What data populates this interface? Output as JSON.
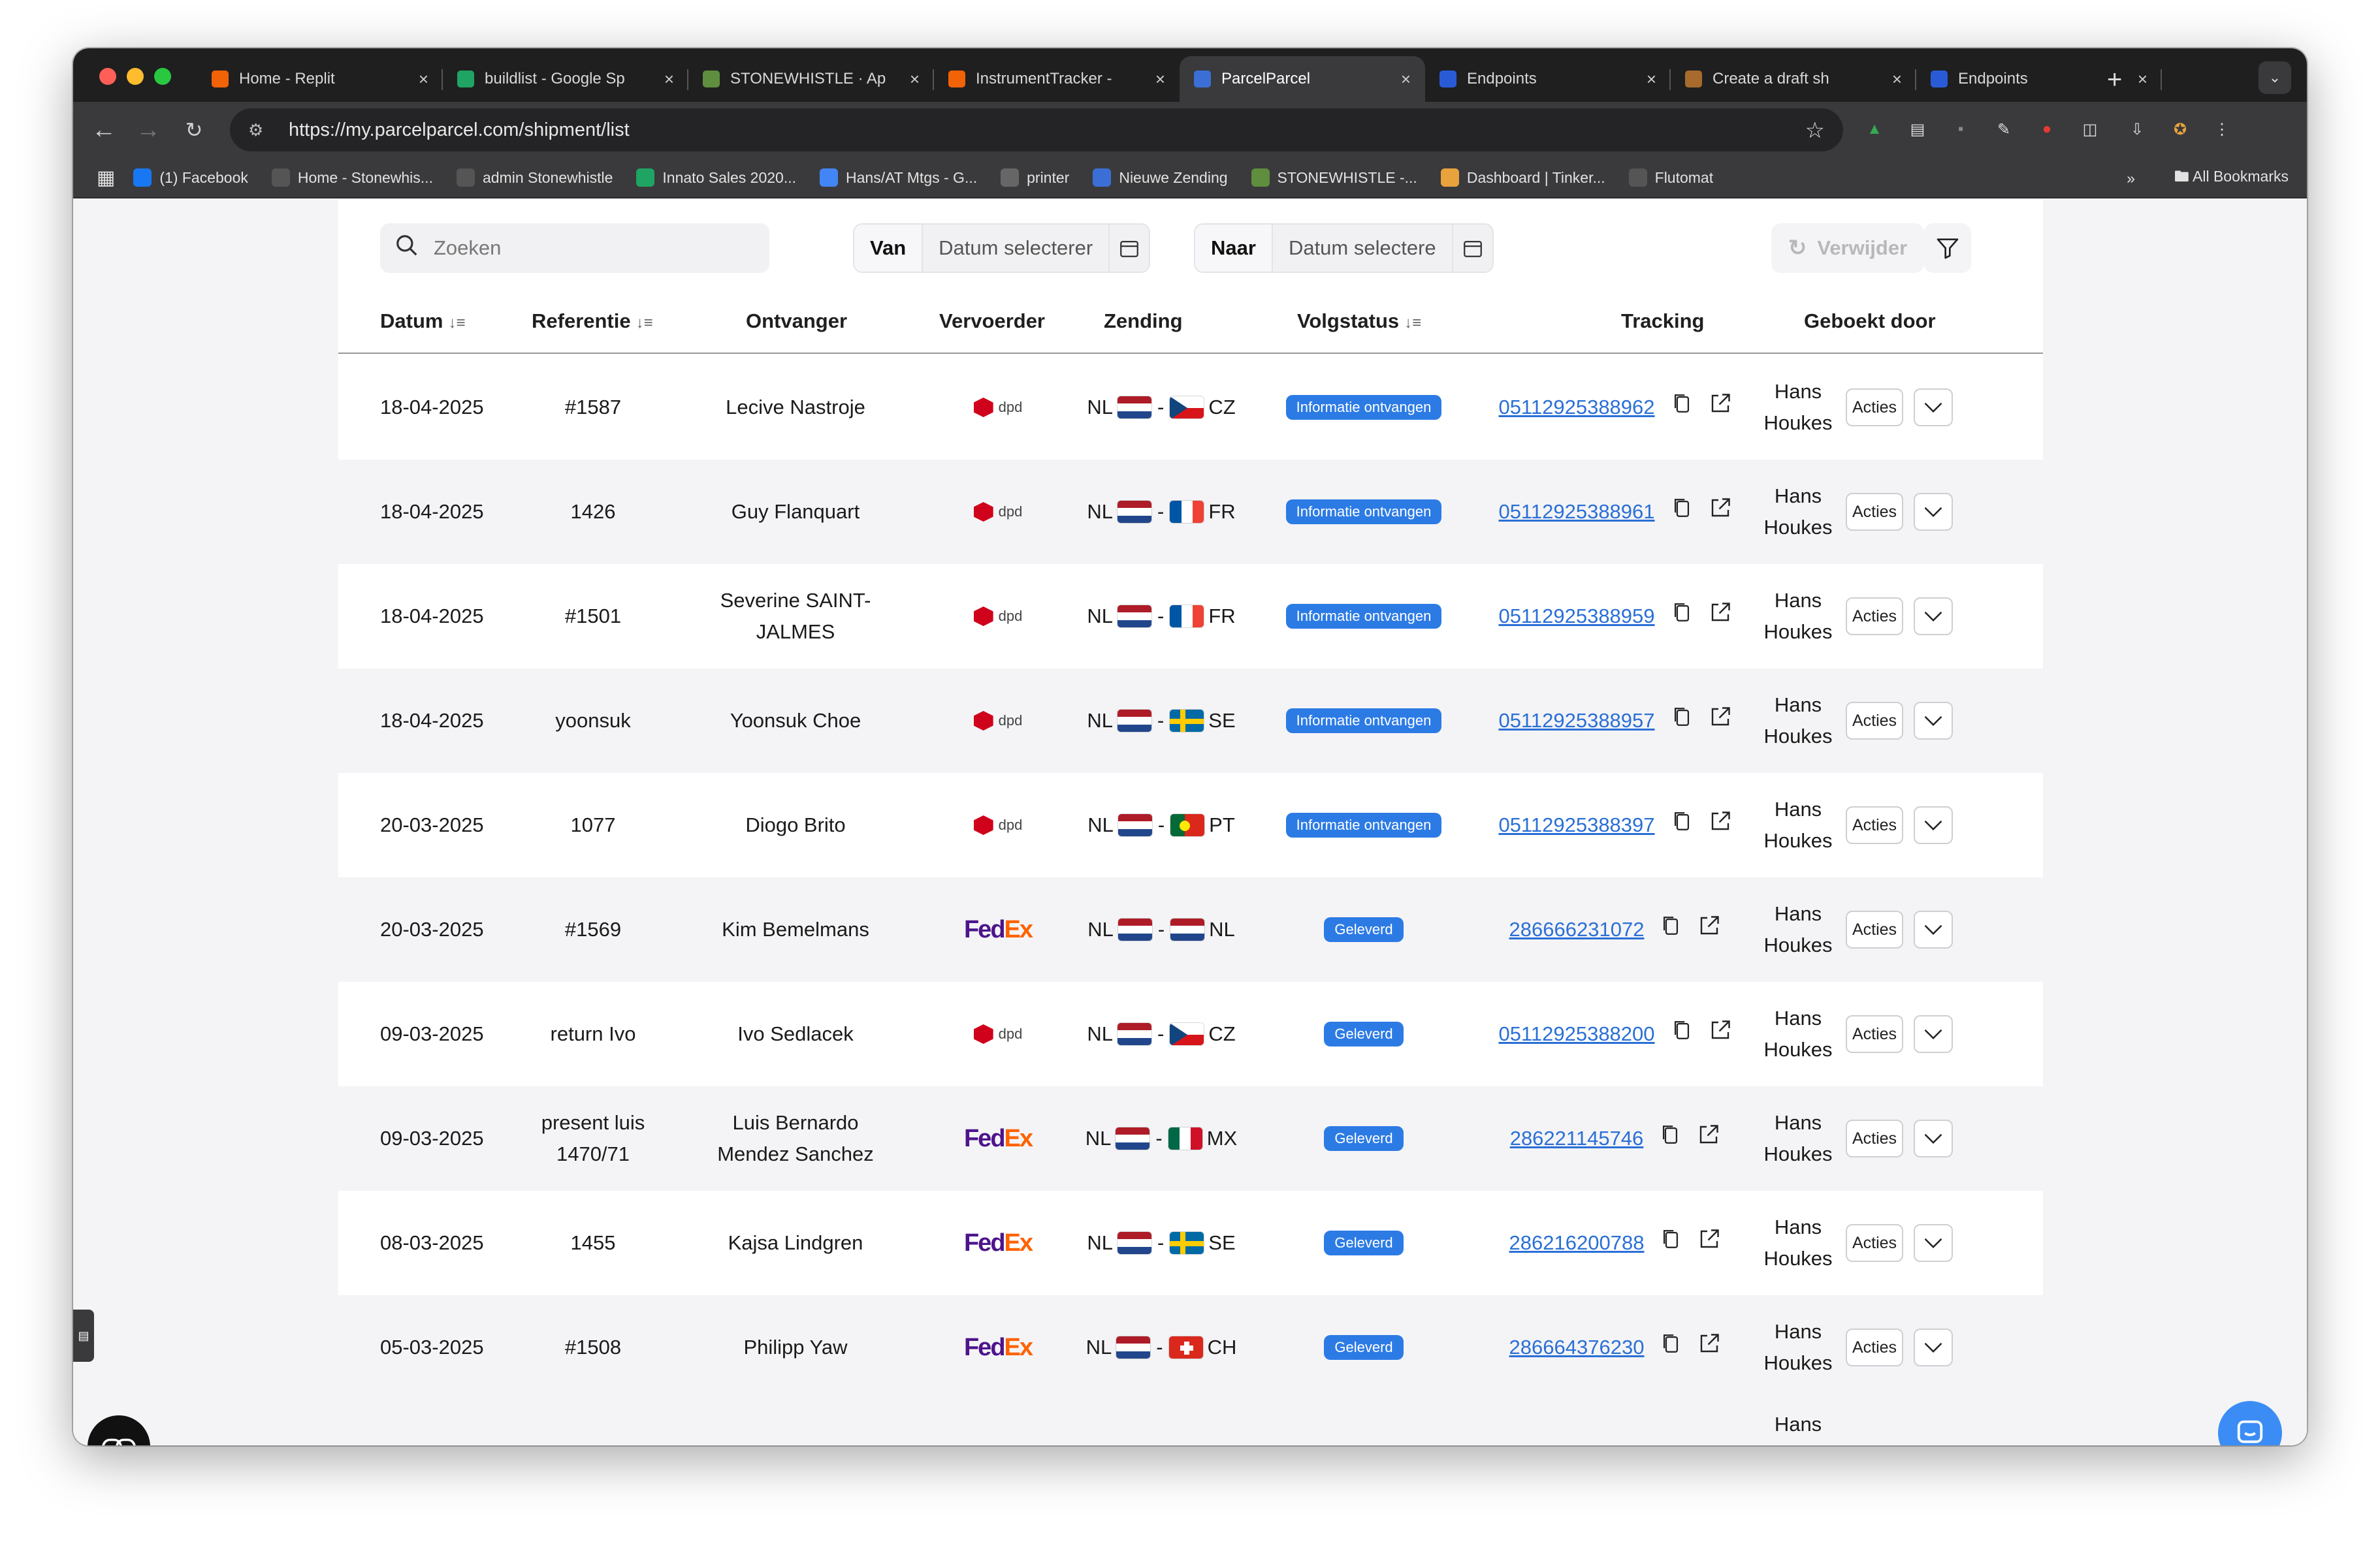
{
  "browser": {
    "tabs": [
      {
        "title": "Home - Replit",
        "icon": "replit-icon",
        "color": "#f26207"
      },
      {
        "title": "buildlist - Google Sp",
        "icon": "sheets-icon",
        "color": "#1fa463"
      },
      {
        "title": "STONEWHISTLE · Ap",
        "icon": "shopify-icon",
        "color": "#5e8e3e"
      },
      {
        "title": "InstrumentTracker -",
        "icon": "replit-icon",
        "color": "#f26207"
      },
      {
        "title": "ParcelParcel",
        "icon": "parcelparcel-icon",
        "color": "#3b6fd6",
        "active": true
      },
      {
        "title": "Endpoints",
        "icon": "docs-icon",
        "color": "#2a5bd7"
      },
      {
        "title": "Create a draft sh",
        "icon": "box-icon",
        "color": "#a86b2d"
      },
      {
        "title": "Endpoints",
        "icon": "docs-icon",
        "color": "#2a5bd7"
      }
    ],
    "url": "https://my.parcelparcel.com/shipment/list",
    "bookmarks": [
      {
        "label": "(1) Facebook",
        "icon": "facebook-icon",
        "color": "#1877f2"
      },
      {
        "label": "Home - Stonewhis...",
        "icon": "globe-icon",
        "color": "#555"
      },
      {
        "label": "admin Stonewhistle",
        "icon": "globe-icon",
        "color": "#555"
      },
      {
        "label": "Innato Sales 2020...",
        "icon": "sheets-icon",
        "color": "#1fa463"
      },
      {
        "label": "Hans/AT Mtgs - G...",
        "icon": "docs-icon",
        "color": "#4285f4"
      },
      {
        "label": "printer",
        "icon": "printer-icon",
        "color": "#666"
      },
      {
        "label": "Nieuwe Zending",
        "icon": "parcelparcel-icon",
        "color": "#3b6fd6"
      },
      {
        "label": "STONEWHISTLE -...",
        "icon": "shopify-icon",
        "color": "#5e8e3e"
      },
      {
        "label": "Dashboard | Tinker...",
        "icon": "tinkercad-icon",
        "color": "#e8a33d"
      },
      {
        "label": "Flutomat",
        "icon": "globe-icon",
        "color": "#555"
      }
    ],
    "all_bookmarks": "All Bookmarks"
  },
  "filters": {
    "search_placeholder": "Zoeken",
    "from_label": "Van",
    "from_placeholder": "Datum selecterer",
    "to_label": "Naar",
    "to_placeholder": "Datum selectere",
    "delete_label": "Verwijder"
  },
  "columns": {
    "date": "Datum",
    "reference": "Referentie",
    "recipient": "Ontvanger",
    "carrier": "Vervoerder",
    "shipment": "Zending",
    "status": "Volgstatus",
    "tracking": "Tracking",
    "booked_by": "Geboekt door"
  },
  "actions_label": "Acties",
  "rows": [
    {
      "date": "18-04-2025",
      "ref": "#1587",
      "recipient": "Lecive Nastroje",
      "carrier": "dpd",
      "from": "NL",
      "to": "CZ",
      "status": "Informatie ontvangen",
      "tracking": "05112925388962",
      "by": "Hans Houkes"
    },
    {
      "date": "18-04-2025",
      "ref": "1426",
      "recipient": "Guy Flanquart",
      "carrier": "dpd",
      "from": "NL",
      "to": "FR",
      "status": "Informatie ontvangen",
      "tracking": "05112925388961",
      "by": "Hans Houkes"
    },
    {
      "date": "18-04-2025",
      "ref": "#1501",
      "recipient": "Severine SAINT-JALMES",
      "carrier": "dpd",
      "from": "NL",
      "to": "FR",
      "status": "Informatie ontvangen",
      "tracking": "05112925388959",
      "by": "Hans Houkes"
    },
    {
      "date": "18-04-2025",
      "ref": "yoonsuk",
      "recipient": "Yoonsuk Choe",
      "carrier": "dpd",
      "from": "NL",
      "to": "SE",
      "status": "Informatie ontvangen",
      "tracking": "05112925388957",
      "by": "Hans Houkes"
    },
    {
      "date": "20-03-2025",
      "ref": "1077",
      "recipient": "Diogo Brito",
      "carrier": "dpd",
      "from": "NL",
      "to": "PT",
      "status": "Informatie ontvangen",
      "tracking": "05112925388397",
      "by": "Hans Houkes"
    },
    {
      "date": "20-03-2025",
      "ref": "#1569",
      "recipient": "Kim Bemelmans",
      "carrier": "FedEx",
      "from": "NL",
      "to": "NL",
      "status": "Geleverd",
      "tracking": "286666231072",
      "by": "Hans Houkes"
    },
    {
      "date": "09-03-2025",
      "ref": "return Ivo",
      "recipient": "Ivo Sedlacek",
      "carrier": "dpd",
      "from": "NL",
      "to": "CZ",
      "status": "Geleverd",
      "tracking": "05112925388200",
      "by": "Hans Houkes"
    },
    {
      "date": "09-03-2025",
      "ref": "present luis 1470/71",
      "recipient": "Luis Bernardo Mendez Sanchez",
      "carrier": "FedEx",
      "from": "NL",
      "to": "MX",
      "status": "Geleverd",
      "tracking": "286221145746",
      "by": "Hans Houkes"
    },
    {
      "date": "08-03-2025",
      "ref": "1455",
      "recipient": "Kajsa Lindgren",
      "carrier": "FedEx",
      "from": "NL",
      "to": "SE",
      "status": "Geleverd",
      "tracking": "286216200788",
      "by": "Hans Houkes"
    },
    {
      "date": "05-03-2025",
      "ref": "#1508",
      "recipient": "Philipp Yaw",
      "carrier": "FedEx",
      "from": "NL",
      "to": "CH",
      "status": "Geleverd",
      "tracking": "286664376230",
      "by": "Hans Houkes"
    }
  ],
  "partial_row": {
    "by": "Hans"
  },
  "colors": {
    "accent": "#2c7be5",
    "link": "#2a6fd6"
  }
}
